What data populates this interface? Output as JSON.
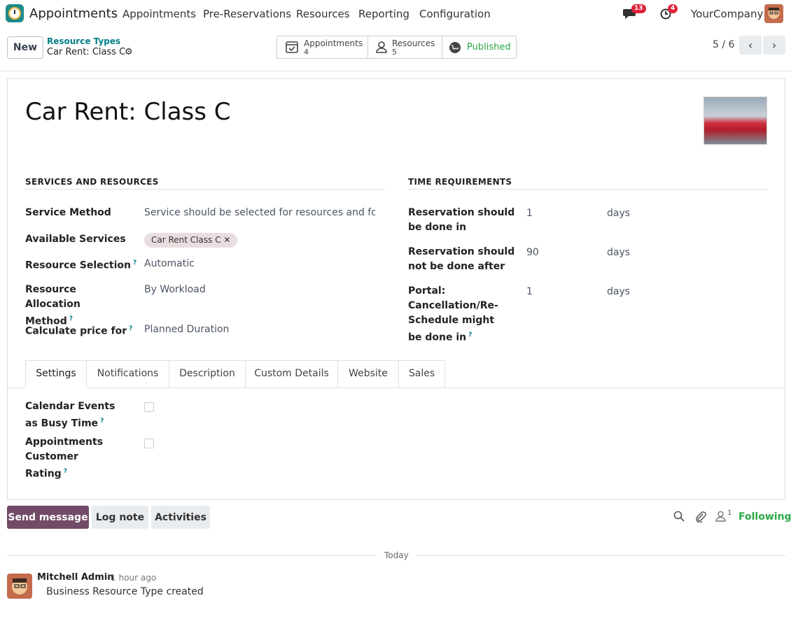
{
  "nav": {
    "app_name": "Appointments",
    "menu": [
      "Appointments",
      "Pre-Reservations",
      "Resources",
      "Reporting",
      "Configuration"
    ],
    "messages_count": "13",
    "activities_count": "4",
    "company": "YourCompany"
  },
  "control": {
    "new_label": "New",
    "breadcrumb_parent": "Resource Types",
    "breadcrumb_current": "Car Rent: Class C",
    "smart_buttons": [
      {
        "label": "Appointments",
        "value": "4",
        "icon": "calendar-check-icon"
      },
      {
        "label": "Resources",
        "value": "5",
        "icon": "user-icon"
      },
      {
        "label": "Published",
        "value": "",
        "icon": "globe-icon",
        "color": "#28a745"
      }
    ],
    "pager": "5 / 6"
  },
  "record": {
    "title": "Car Rent: Class C",
    "services": {
      "heading": "SERVICES AND RESOURCES",
      "service_method_label": "Service Method",
      "service_method_value": "Service should be selected for resources and for ap",
      "available_services_label": "Available Services",
      "available_services_tag": "Car Rent Class C ✕",
      "resource_selection_label": "Resource Selection",
      "resource_selection_value": "Automatic",
      "allocation_label": "Resource Allocation Method",
      "allocation_value": "By Workload",
      "price_label": "Calculate price for",
      "price_value": "Planned Duration"
    },
    "time": {
      "heading": "TIME REQUIREMENTS",
      "rows": [
        {
          "label": "Reservation should be done in",
          "value": "1",
          "unit": "days"
        },
        {
          "label": "Reservation should not be done after",
          "value": "90",
          "unit": "days"
        },
        {
          "label": "Portal: Cancellation/Re-Schedule might be done in",
          "value": "1",
          "unit": "days"
        }
      ]
    },
    "tabs": [
      "Settings",
      "Notifications",
      "Description",
      "Custom Details",
      "Website",
      "Sales"
    ],
    "settings": {
      "calendar_busy_label": "Calendar Events as Busy Time",
      "customer_rating_label": "Appointments Customer Rating"
    }
  },
  "chatter": {
    "send_message": "Send message",
    "log_note": "Log note",
    "activities": "Activities",
    "followers_count": "1",
    "following": "Following",
    "today": "Today",
    "author": "Mitchell Admin",
    "time": "- 1 hour ago",
    "body": "Business Resource Type created"
  },
  "colors": {
    "brand": "#714b67",
    "link": "#017e84",
    "published": "#28a745",
    "badge": "#e0223b"
  }
}
